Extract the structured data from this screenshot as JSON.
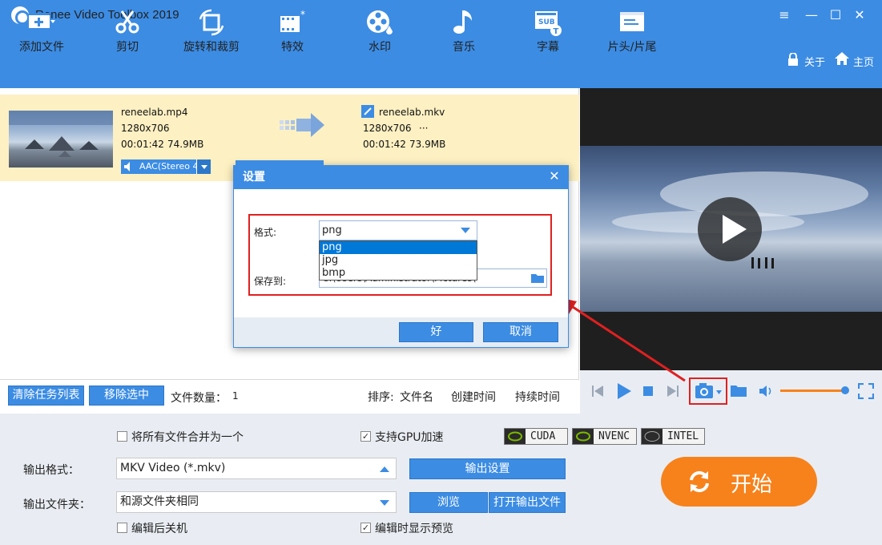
{
  "app": {
    "title": "Renee Video Toolbox 2019",
    "window_controls": [
      "≡",
      "—",
      "☐",
      "✕"
    ]
  },
  "toolbar": {
    "items": [
      {
        "label": "添加文件",
        "icon": "add-file-icon"
      },
      {
        "label": "剪切",
        "icon": "scissors-icon"
      },
      {
        "label": "旋转和裁剪",
        "icon": "crop-rotate-icon"
      },
      {
        "label": "特效",
        "icon": "effects-icon"
      },
      {
        "label": "水印",
        "icon": "watermark-icon"
      },
      {
        "label": "音乐",
        "icon": "music-note-icon"
      },
      {
        "label": "字幕",
        "icon": "subtitle-icon"
      },
      {
        "label": "片头/片尾",
        "icon": "intro-outro-icon"
      }
    ],
    "about": "关于",
    "home": "主页"
  },
  "task": {
    "source": {
      "name": "reneelab.mp4",
      "resolution": "1280x706",
      "duration": "00:01:42",
      "size": "74.9MB"
    },
    "output": {
      "name": "reneelab.mkv",
      "resolution": "1280x706",
      "extra": "···",
      "duration": "00:01:42",
      "size": "73.9MB"
    },
    "audio_track": "AAC(Stereo 4"
  },
  "list_footer": {
    "clear_button": "清除任务列表",
    "remove_button": "移除选中",
    "file_count_label": "文件数量：",
    "file_count": "1",
    "sort_label": "排序:",
    "sort_name": "文件名",
    "sort_created": "创建时间",
    "sort_duration": "持续时间"
  },
  "dialog": {
    "title": "设置",
    "format_label": "格式:",
    "format_value": "png",
    "format_options": [
      "png",
      "jpg",
      "bmp"
    ],
    "save_label": "保存到:",
    "save_path": "C:\\Users\\Administrator\\Pictures\\",
    "ok": "好",
    "cancel": "取消"
  },
  "settings": {
    "merge_label": "将所有文件合并为一个",
    "gpu_label": "支持GPU加速",
    "gpu_badges": [
      "CUDA",
      "NVENC",
      "INTEL"
    ],
    "output_format_label": "输出格式：",
    "output_format": "MKV Video (*.mkv)",
    "output_settings_button": "输出设置",
    "output_folder_label": "输出文件夹：",
    "output_folder": "和源文件夹相同",
    "browse_button": "浏览",
    "open_output_button": "打开输出文件",
    "shutdown_label": "编辑后关机",
    "preview_label": "编辑时显示预览",
    "start_button": "开始"
  },
  "colors": {
    "brand_blue": "#3c8ce3",
    "start_orange": "#f7821b",
    "highlight_red": "#e02020",
    "task_row_bg": "#fdf0c2"
  }
}
